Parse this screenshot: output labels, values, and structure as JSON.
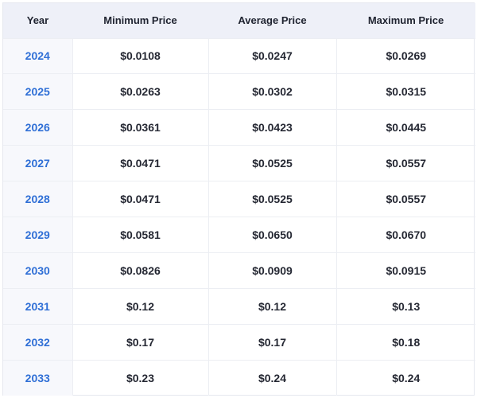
{
  "table": {
    "headers": {
      "year": "Year",
      "min": "Minimum Price",
      "avg": "Average Price",
      "max": "Maximum Price"
    },
    "rows": [
      {
        "year": "2024",
        "min": "$0.0108",
        "avg": "$0.0247",
        "max": "$0.0269"
      },
      {
        "year": "2025",
        "min": "$0.0263",
        "avg": "$0.0302",
        "max": "$0.0315"
      },
      {
        "year": "2026",
        "min": "$0.0361",
        "avg": "$0.0423",
        "max": "$0.0445"
      },
      {
        "year": "2027",
        "min": "$0.0471",
        "avg": "$0.0525",
        "max": "$0.0557"
      },
      {
        "year": "2028",
        "min": "$0.0471",
        "avg": "$0.0525",
        "max": "$0.0557"
      },
      {
        "year": "2029",
        "min": "$0.0581",
        "avg": "$0.0650",
        "max": "$0.0670"
      },
      {
        "year": "2030",
        "min": "$0.0826",
        "avg": "$0.0909",
        "max": "$0.0915"
      },
      {
        "year": "2031",
        "min": "$0.12",
        "avg": "$0.12",
        "max": "$0.13"
      },
      {
        "year": "2032",
        "min": "$0.17",
        "avg": "$0.17",
        "max": "$0.18"
      },
      {
        "year": "2033",
        "min": "$0.23",
        "avg": "$0.24",
        "max": "$0.24"
      }
    ]
  },
  "colors": {
    "header_bg": "#eef0f8",
    "year_text": "#2f6fd6",
    "year_bg": "#f7f8fc",
    "border": "#eceef3"
  }
}
